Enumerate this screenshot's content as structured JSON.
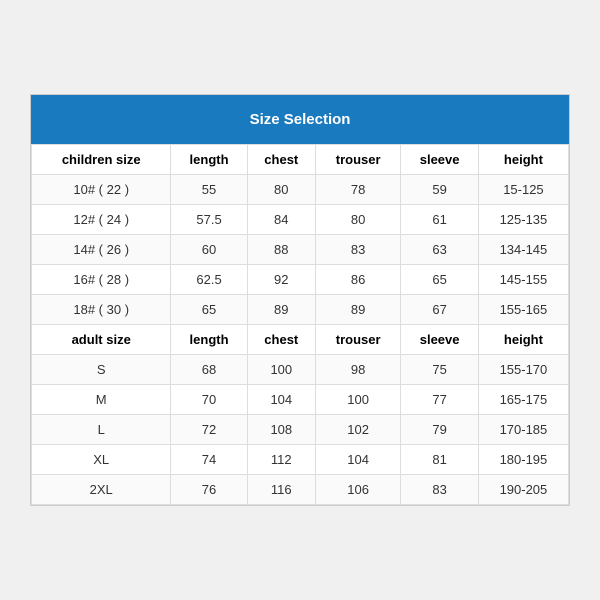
{
  "title": "Size Selection",
  "children_section": {
    "label": "children size",
    "headers": [
      "children size",
      "length",
      "chest",
      "trouser",
      "sleeve",
      "height"
    ],
    "rows": [
      {
        "size": "10# ( 22 )",
        "length": "55",
        "chest": "80",
        "trouser": "78",
        "sleeve": "59",
        "height": "15-125"
      },
      {
        "size": "12# ( 24 )",
        "length": "57.5",
        "chest": "84",
        "trouser": "80",
        "sleeve": "61",
        "height": "125-135"
      },
      {
        "size": "14# ( 26 )",
        "length": "60",
        "chest": "88",
        "trouser": "83",
        "sleeve": "63",
        "height": "134-145"
      },
      {
        "size": "16# ( 28 )",
        "length": "62.5",
        "chest": "92",
        "trouser": "86",
        "sleeve": "65",
        "height": "145-155"
      },
      {
        "size": "18# ( 30 )",
        "length": "65",
        "chest": "89",
        "trouser": "89",
        "sleeve": "67",
        "height": "155-165"
      }
    ]
  },
  "adult_section": {
    "label": "adult size",
    "headers": [
      "adult size",
      "length",
      "chest",
      "trouser",
      "sleeve",
      "height"
    ],
    "rows": [
      {
        "size": "S",
        "length": "68",
        "chest": "100",
        "trouser": "98",
        "sleeve": "75",
        "height": "155-170"
      },
      {
        "size": "M",
        "length": "70",
        "chest": "104",
        "trouser": "100",
        "sleeve": "77",
        "height": "165-175"
      },
      {
        "size": "L",
        "length": "72",
        "chest": "108",
        "trouser": "102",
        "sleeve": "79",
        "height": "170-185"
      },
      {
        "size": "XL",
        "length": "74",
        "chest": "112",
        "trouser": "104",
        "sleeve": "81",
        "height": "180-195"
      },
      {
        "size": "2XL",
        "length": "76",
        "chest": "116",
        "trouser": "106",
        "sleeve": "83",
        "height": "190-205"
      }
    ]
  }
}
